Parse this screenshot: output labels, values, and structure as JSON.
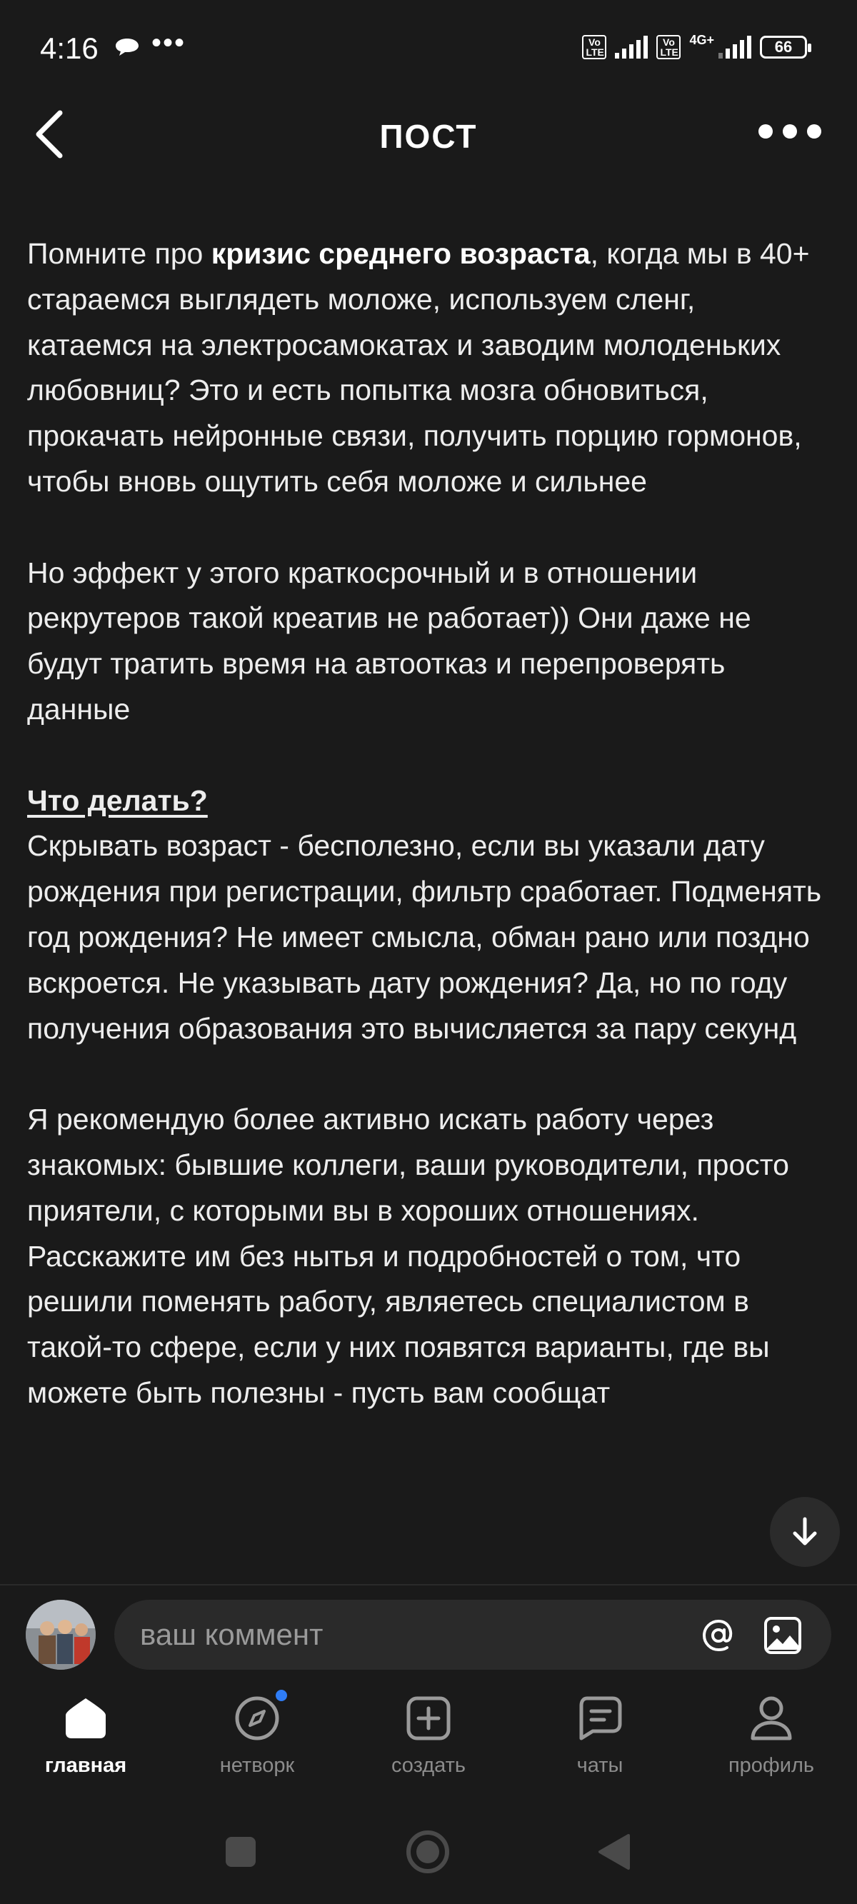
{
  "status_bar": {
    "time": "4:16",
    "dots": "•••",
    "volte_label": "Vo LTE",
    "network": "4G+",
    "battery": "66"
  },
  "header": {
    "title": "ПОСТ"
  },
  "article": {
    "p1_before": "Помните про ",
    "p1_bold": "кризис среднего возраста",
    "p1_after": ", когда мы в 40+ стараемся выглядеть моложе, используем сленг, катаемся на электросамокатах и заводим молоденьких любовниц? Это и есть попытка мозга обновиться, прокачать нейронные связи, получить порцию гормонов, чтобы вновь ощутить себя моложе и сильнее",
    "p2": "Но эффект у этого краткосрочный и в отношении рекрутеров такой креатив не работает)) Они даже не будут тратить время на автоотказ и перепроверять данные",
    "p3_heading": "Что делать?",
    "p3": "Скрывать возраст - бесполезно, если вы указали дату рождения при регистрации, фильтр сработает. Подменять год рождения? Не имеет смысла, обман рано или поздно вскроется. Не указывать дату рождения? Да, но по году получения образования это вычисляется за пару секунд",
    "p4": "Я рекомендую более активно искать работу через знакомых: бывшие коллеги, ваши руководители, просто приятели, с которыми вы в хороших отношениях. Расскажите им без нытья и подробностей о том, что решили поменять работу, являетесь специалистом в такой-то сфере, если у них появятся варианты, где вы можете быть полезны - пусть вам сообщат"
  },
  "comment": {
    "placeholder": "ваш коммент"
  },
  "nav": {
    "items": [
      {
        "label": "главная",
        "icon": "home-icon",
        "active": true
      },
      {
        "label": "нетворк",
        "icon": "compass-icon",
        "active": false
      },
      {
        "label": "создать",
        "icon": "plus-square-icon",
        "active": false
      },
      {
        "label": "чаты",
        "icon": "chat-icon",
        "active": false
      },
      {
        "label": "профиль",
        "icon": "profile-icon",
        "active": false
      }
    ]
  },
  "colors": {
    "background": "#1a1a1a",
    "surface": "#2a2a2a",
    "accent_dot": "#2f7df6",
    "text": "#f2f2f2",
    "muted": "#8c8c8c"
  }
}
